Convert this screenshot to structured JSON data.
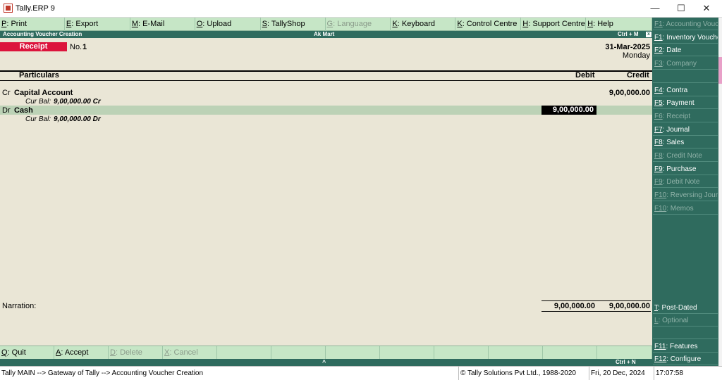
{
  "window": {
    "title": "Tally.ERP 9",
    "minimize": "—",
    "maximize": "☐",
    "close": "✕"
  },
  "top_menu": [
    {
      "key": "P",
      "label": ": Print",
      "disabled": false,
      "w": 92
    },
    {
      "key": "E",
      "label": ": Export",
      "disabled": false,
      "w": 93
    },
    {
      "key": "M",
      "label": ": E-Mail",
      "disabled": false,
      "w": 92
    },
    {
      "key": "O",
      "label": ": Upload",
      "disabled": false,
      "w": 93
    },
    {
      "key": "S",
      "label": ": TallyShop",
      "disabled": false,
      "w": 92
    },
    {
      "key": "G",
      "label": ": Language",
      "disabled": true,
      "w": 93
    },
    {
      "key": "K",
      "label": ": Keyboard",
      "disabled": false,
      "w": 92
    },
    {
      "key": "K",
      "label": ": Control Centre",
      "disabled": false,
      "w": 93
    },
    {
      "key": "H",
      "label": ": Support Centre",
      "disabled": false,
      "w": 92
    },
    {
      "key": "H",
      "label": ": Help",
      "disabled": false,
      "w": 93
    }
  ],
  "header": {
    "screen": "Accounting Voucher  Creation",
    "company": "Ak Mart",
    "shortcut": "Ctrl + M",
    "close": "x"
  },
  "voucher": {
    "type": "Receipt",
    "no_label": "No.",
    "no": "1",
    "date": "31-Mar-2025",
    "day": "Monday"
  },
  "columns": {
    "particulars": "Particulars",
    "debit": "Debit",
    "credit": "Credit"
  },
  "entries": [
    {
      "drcr": "Cr",
      "ledger": "Capital Account",
      "cur_bal_label": "Cur Bal:",
      "cur_bal": "9,00,000.00 Cr",
      "debit": "",
      "credit": "9,00,000.00"
    },
    {
      "drcr": "Dr",
      "ledger": "Cash",
      "cur_bal_label": "Cur Bal:",
      "cur_bal": "9,00,000.00 Dr",
      "debit": "9,00,000.00",
      "credit": ""
    }
  ],
  "narration": {
    "label": "Narration:",
    "total_debit": "9,00,000.00",
    "total_credit": "9,00,000.00"
  },
  "bottom_menu": [
    {
      "key": "Q",
      "label": ": Quit",
      "disabled": false
    },
    {
      "key": "A",
      "label": ": Accept",
      "disabled": false
    },
    {
      "key": "D",
      "label": ": Delete",
      "disabled": true
    },
    {
      "key": "X",
      "label": ": Cancel",
      "disabled": true
    },
    {
      "key": "",
      "label": "",
      "disabled": false
    },
    {
      "key": "",
      "label": "",
      "disabled": false
    },
    {
      "key": "",
      "label": "",
      "disabled": false
    },
    {
      "key": "",
      "label": "",
      "disabled": false
    },
    {
      "key": "",
      "label": "",
      "disabled": false
    },
    {
      "key": "",
      "label": "",
      "disabled": false
    },
    {
      "key": "",
      "label": "",
      "disabled": false
    },
    {
      "key": "",
      "label": "",
      "disabled": false
    }
  ],
  "bottom_strip": {
    "shortcut": "Ctrl + N",
    "chevron": "^"
  },
  "status_bar": {
    "path": "Tally MAIN --> Gateway of Tally --> Accounting Voucher  Creation",
    "copyright": "© Tally Solutions Pvt Ltd., 1988-2020",
    "date": "Fri, 20 Dec, 2024",
    "time": "17:07:58"
  },
  "right_panel": [
    {
      "key": "F1",
      "label": ": Accounting Vouchers",
      "disabled": true
    },
    {
      "key": "F1",
      "label": ": Inventory Vouchers",
      "disabled": false
    },
    {
      "key": "F2",
      "label": ": Date",
      "disabled": false
    },
    {
      "key": "F3",
      "label": ": Company",
      "disabled": true
    },
    {
      "key": "",
      "label": "",
      "disabled": false
    },
    {
      "key": "F4",
      "label": ": Contra",
      "disabled": false
    },
    {
      "key": "F5",
      "label": ": Payment",
      "disabled": false
    },
    {
      "key": "F6",
      "label": ": Receipt",
      "disabled": true
    },
    {
      "key": "F7",
      "label": ": Journal",
      "disabled": false
    },
    {
      "key": "F8",
      "label": ": Sales",
      "disabled": false
    },
    {
      "key": "F8",
      "label": ": Credit Note",
      "disabled": true
    },
    {
      "key": "F9",
      "label": ": Purchase",
      "disabled": false
    },
    {
      "key": "F9",
      "label": ": Debit Note",
      "disabled": true
    },
    {
      "key": "F10",
      "label": ": Reversing Journal",
      "disabled": true
    },
    {
      "key": "F10",
      "label": ": Memos",
      "disabled": true
    }
  ],
  "right_panel_bottom": [
    {
      "key": "T",
      "label": ": Post-Dated",
      "disabled": false
    },
    {
      "key": "L",
      "label": ": Optional",
      "disabled": true
    },
    {
      "key": "",
      "label": "",
      "disabled": false
    },
    {
      "key": "F11",
      "label": ": Features",
      "disabled": false
    },
    {
      "key": "F12",
      "label": ": Configure",
      "disabled": false
    }
  ]
}
